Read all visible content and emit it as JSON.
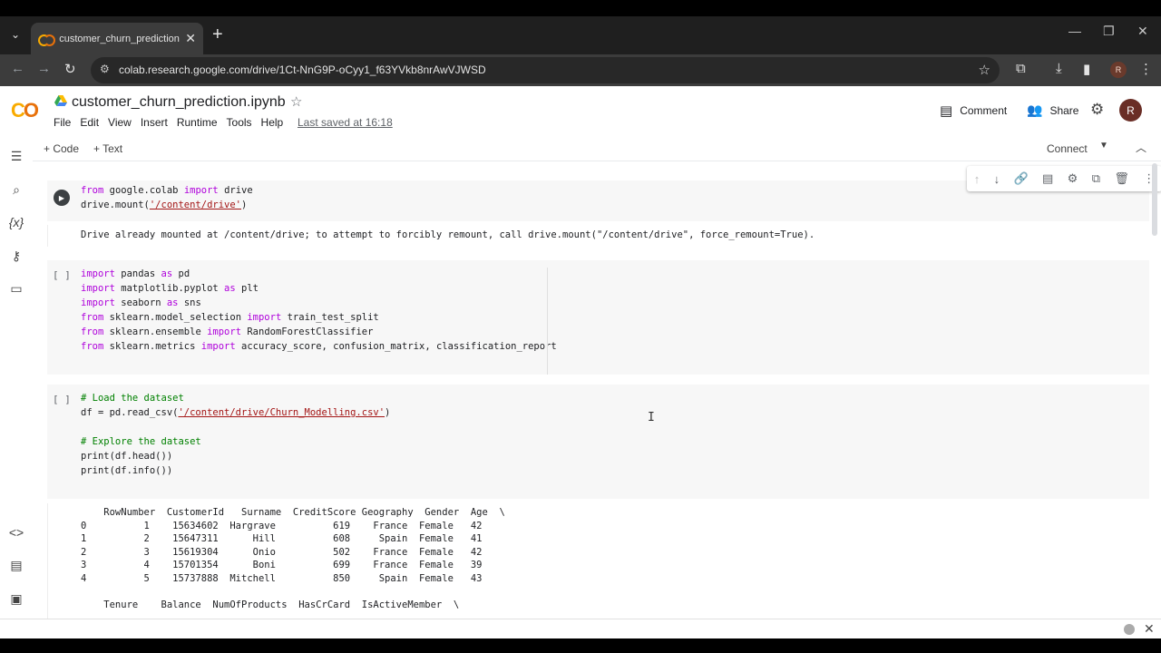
{
  "browser": {
    "tab_title": "customer_churn_prediction.ipynb",
    "url": "colab.research.google.com/drive/1Ct-NnG9P-oCyy1_f63YVkb8nrAwVJWSD",
    "profile_initial": "R"
  },
  "header": {
    "notebook_title": "customer_churn_prediction.ipynb",
    "menu": [
      "File",
      "Edit",
      "View",
      "Insert",
      "Runtime",
      "Tools",
      "Help"
    ],
    "last_saved": "Last saved at 16:18",
    "comment_label": "Comment",
    "share_label": "Share",
    "avatar_initial": "R"
  },
  "toolbar": {
    "add_code": "+ Code",
    "add_text": "+ Text",
    "connect": "Connect"
  },
  "cells": [
    {
      "type": "code",
      "ran": true,
      "output": "Drive already mounted at /content/drive; to attempt to forcibly remount, call drive.mount(\"/content/drive\", force_remount=True)."
    },
    {
      "type": "code",
      "ran": false,
      "bracket": "[ ]"
    },
    {
      "type": "code",
      "ran": false,
      "bracket": "[ ]",
      "output_table_1": {
        "header": "    RowNumber  CustomerId   Surname  CreditScore Geography  Gender  Age  \\",
        "rows": [
          "0          1    15634602  Hargrave          619    France  Female   42",
          "1          2    15647311      Hill          608     Spain  Female   41",
          "2          3    15619304      Onio          502    France  Female   42",
          "3          4    15701354      Boni          699    France  Female   39",
          "4          5    15737888  Mitchell          850     Spain  Female   43"
        ]
      },
      "output_table_2_header": "    Tenure    Balance  NumOfProducts  HasCrCard  IsActiveMember  \\"
    }
  ]
}
